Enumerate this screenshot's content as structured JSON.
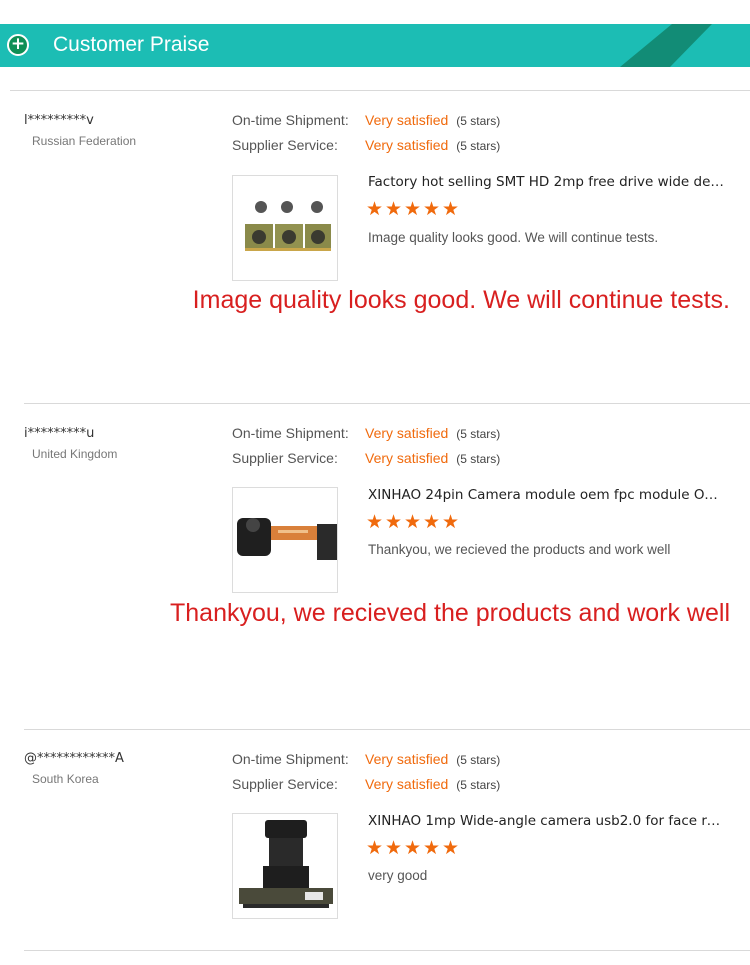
{
  "header": {
    "title": "Customer Praise"
  },
  "reviews": [
    {
      "buyer": "l*********v",
      "country": "Russian Federation",
      "ratings": [
        {
          "label": "On-time Shipment:",
          "value": "Very satisfied",
          "stars_text": "(5 stars)"
        },
        {
          "label": "Supplier Service:",
          "value": "Very satisfied",
          "stars_text": "(5 stars)"
        }
      ],
      "product_title": "Factory hot selling SMT HD 2mp free drive wide degre...",
      "product_image": "camera-board-modules",
      "rating": 5,
      "comment": "Image quality looks good. We will continue tests.",
      "comment_large": "Image quality looks good. We will continue tests."
    },
    {
      "buyer": "i*********u",
      "country": "United Kingdom",
      "ratings": [
        {
          "label": "On-time Shipment:",
          "value": "Very satisfied",
          "stars_text": "(5 stars)"
        },
        {
          "label": "Supplier Service:",
          "value": "Very satisfied",
          "stars_text": "(5 stars)"
        }
      ],
      "product_title": "XINHAO 24pin Camera module oem fpc module OV76...",
      "product_image": "fpc-camera-module",
      "rating": 5,
      "comment": "Thankyou, we recieved the products and work well",
      "comment_large": "Thankyou, we recieved the products and work well"
    },
    {
      "buyer": "@************A",
      "country": "South Korea",
      "ratings": [
        {
          "label": "On-time Shipment:",
          "value": "Very satisfied",
          "stars_text": "(5 stars)"
        },
        {
          "label": "Supplier Service:",
          "value": "Very satisfied",
          "stars_text": "(5 stars)"
        }
      ],
      "product_title": "XINHAO 1mp Wide-angle camera usb2.0 for face reco...",
      "product_image": "usb-lens-camera",
      "rating": 5,
      "comment": "very good"
    }
  ],
  "colors": {
    "header": "#1cbdb4",
    "accent": "#f06a0d",
    "highlight_text": "#d81f1f"
  },
  "icons": {
    "header": "plus-circle-icon",
    "rating": "star-icon"
  }
}
